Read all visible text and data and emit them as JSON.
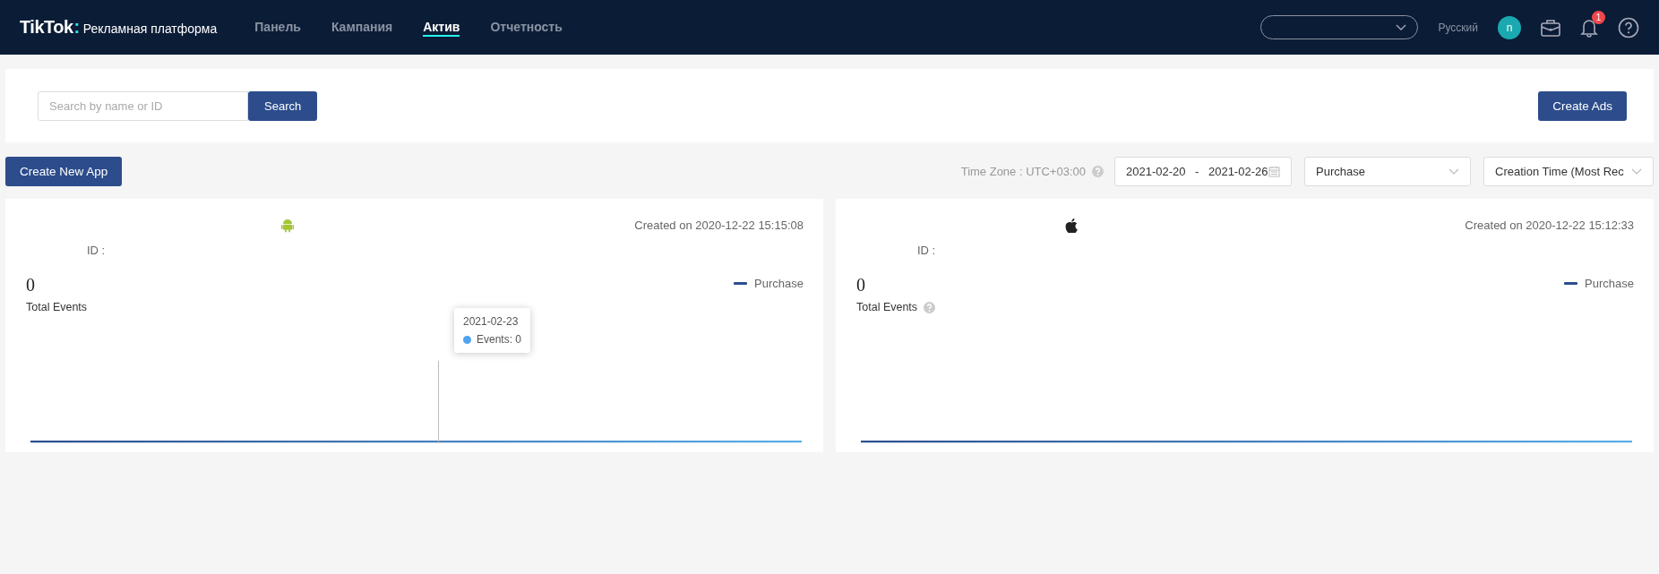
{
  "header": {
    "logo": "TikTok",
    "logo_colon": ":",
    "product": "Рекламная платформа",
    "nav": [
      {
        "label": "Панель",
        "selected": false
      },
      {
        "label": "Кампания",
        "selected": false
      },
      {
        "label": "Актив",
        "selected": true
      },
      {
        "label": "Отчетность",
        "selected": false
      }
    ],
    "language": "Русский",
    "avatar": "n",
    "notifications": "1"
  },
  "search": {
    "placeholder": "Search by name or ID",
    "button": "Search",
    "create": "Create Ads"
  },
  "toolbar": {
    "create_app": "Create New App",
    "timezone": "Time Zone : UTC+03:00",
    "date_start": "2021-02-20",
    "date_sep": "-",
    "date_end": "2021-02-26",
    "event": "Purchase",
    "sort": "Creation Time (Most Rec"
  },
  "apps": [
    {
      "kind": "android",
      "created": "Created on 2020-12-22 15:15:08",
      "id_label": "ID :",
      "total": "0",
      "total_label": "Total Events",
      "help": false,
      "legend": "Purchase",
      "tooltip": {
        "date": "2021-02-23",
        "label": "Events: 0"
      }
    },
    {
      "kind": "ios",
      "created": "Created on 2020-12-22 15:12:33",
      "id_label": "ID :",
      "total": "0",
      "total_label": "Total Events",
      "help": true,
      "legend": "Purchase"
    }
  ]
}
